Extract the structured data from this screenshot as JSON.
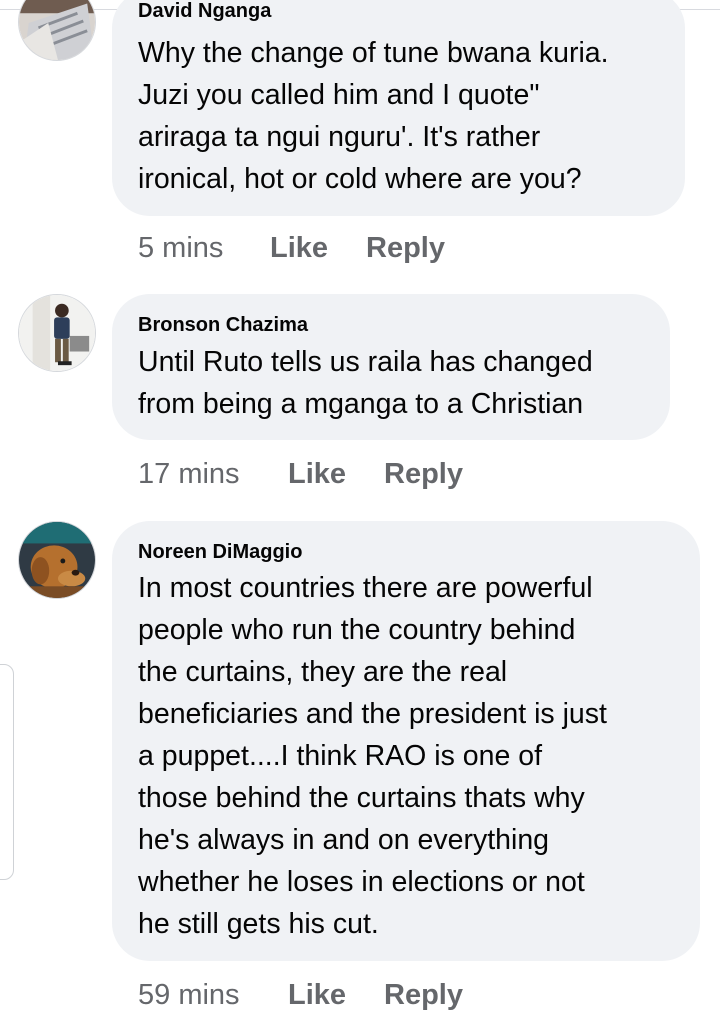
{
  "comments": [
    {
      "author": "David Nganga",
      "lines": [
        "Why the change of tune bwana kuria.",
        "Juzi you called him and I quote\"",
        "ariraga ta ngui nguru'. It's rather",
        "ironical,  hot or cold  where are you?"
      ],
      "time": "5 mins",
      "like_label": "Like",
      "reply_label": "Reply"
    },
    {
      "author": "Bronson Chazima",
      "lines": [
        "Until Ruto tells us raila has changed",
        "from being a mganga to a Christian"
      ],
      "time": "17 mins",
      "like_label": "Like",
      "reply_label": "Reply"
    },
    {
      "author": "Noreen DiMaggio",
      "lines": [
        "In most countries  there are powerful",
        "people who run the country behind",
        "the curtains, they are the real",
        "beneficiaries and the president  is just",
        "a puppet....I think RAO is one of",
        "those behind  the curtains  thats why",
        "he's always in and on everything",
        "whether  he loses in elections or not",
        "he still gets his cut."
      ],
      "time": "59 mins",
      "like_label": "Like",
      "reply_label": "Reply"
    }
  ],
  "colors": {
    "bubble": "#f0f2f5",
    "text": "#050505",
    "meta": "#65676b"
  }
}
